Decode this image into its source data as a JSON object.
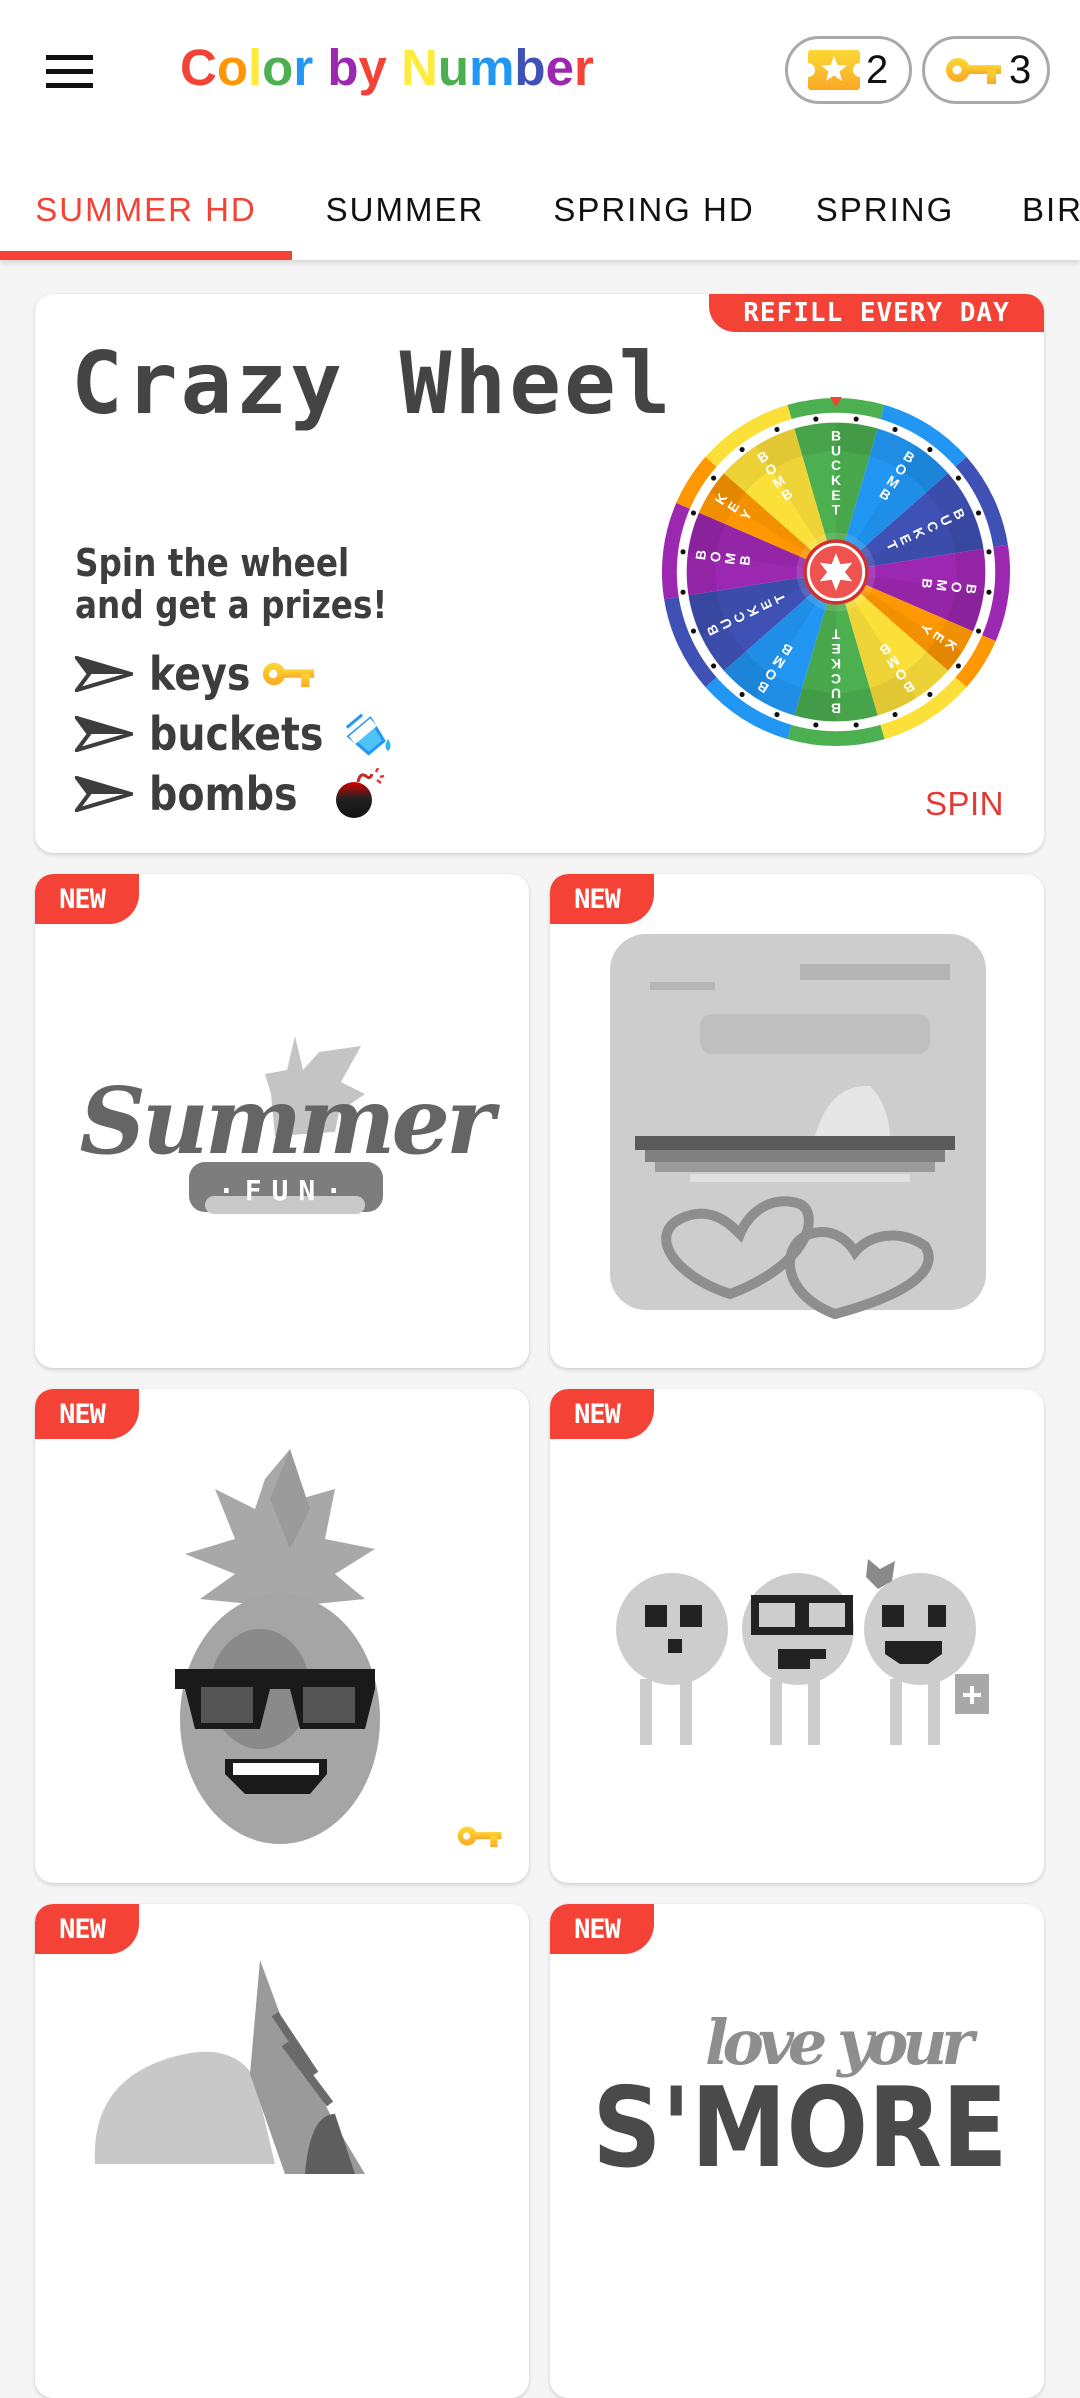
{
  "app": {
    "title_letters": [
      {
        "ch": "C",
        "color": "#f44336"
      },
      {
        "ch": "o",
        "color": "#ff9800"
      },
      {
        "ch": "l",
        "color": "#ffeb3b"
      },
      {
        "ch": "o",
        "color": "#4caf50"
      },
      {
        "ch": "r",
        "color": "#2196f3"
      },
      {
        "ch": " ",
        "color": "#000000"
      },
      {
        "ch": "b",
        "color": "#9c27b0"
      },
      {
        "ch": "y",
        "color": "#f44336"
      },
      {
        "ch": " ",
        "color": "#000000"
      },
      {
        "ch": "N",
        "color": "#ffeb3b"
      },
      {
        "ch": "u",
        "color": "#4caf50"
      },
      {
        "ch": "m",
        "color": "#2196f3"
      },
      {
        "ch": "b",
        "color": "#3f51b5"
      },
      {
        "ch": "e",
        "color": "#9c27b0"
      },
      {
        "ch": "r",
        "color": "#f44336"
      }
    ],
    "title": "Color by Number",
    "menu_icon": "hamburger-menu-icon",
    "tickets": {
      "icon": "ticket-star-icon",
      "count": "2"
    },
    "keys": {
      "icon": "key-icon",
      "count": "3"
    }
  },
  "tabs": [
    {
      "label": "SUMMER HD",
      "active": true
    },
    {
      "label": "SUMMER",
      "active": false
    },
    {
      "label": "SPRING HD",
      "active": false
    },
    {
      "label": "SPRING",
      "active": false
    },
    {
      "label": "BIR",
      "active": false
    }
  ],
  "wheel_card": {
    "badge": "REFILL EVERY DAY",
    "title": "Crazy Wheel",
    "description": "Spin the wheel and get a prizes!",
    "prizes": [
      {
        "label": "keys",
        "icon": "key-icon"
      },
      {
        "label": "buckets",
        "icon": "paint-bucket-icon"
      },
      {
        "label": "bombs",
        "icon": "bomb-icon"
      }
    ],
    "spin_label": "SPIN",
    "wheel_segments": [
      {
        "label": "BUCKET",
        "color": "#4caf50"
      },
      {
        "label": "BOMB",
        "color": "#2196f3"
      },
      {
        "label": "BUCKET",
        "color": "#3f51b5"
      },
      {
        "label": "BOMB",
        "color": "#9c27b0"
      },
      {
        "label": "KEY",
        "color": "#ff9800"
      },
      {
        "label": "BOMB",
        "color": "#fbe03a"
      },
      {
        "label": "BUCKET",
        "color": "#4caf50"
      },
      {
        "label": "BOMB",
        "color": "#2196f3"
      },
      {
        "label": "BUCKET",
        "color": "#3f51b5"
      },
      {
        "label": "BOMB",
        "color": "#9c27b0"
      },
      {
        "label": "KEY",
        "color": "#ff9800"
      },
      {
        "label": "BOMB",
        "color": "#fbe03a"
      }
    ],
    "hub_icon": "star-icon"
  },
  "pictures": [
    {
      "badge": "NEW",
      "subject": "Summer Fun",
      "locked": false
    },
    {
      "badge": "NEW",
      "subject": "Sunset hearts",
      "locked": false
    },
    {
      "badge": "NEW",
      "subject": "Pineapple with sunglasses",
      "locked": true
    },
    {
      "badge": "NEW",
      "subject": "Three friends",
      "locked": false
    },
    {
      "badge": "NEW",
      "subject": "Seashell",
      "locked": false
    },
    {
      "badge": "NEW",
      "subject": "S'MORE",
      "locked": false
    }
  ],
  "colors": {
    "accent": "#f44336",
    "key_gold": "#fbc02d",
    "text_dark": "#3d3d3d"
  }
}
